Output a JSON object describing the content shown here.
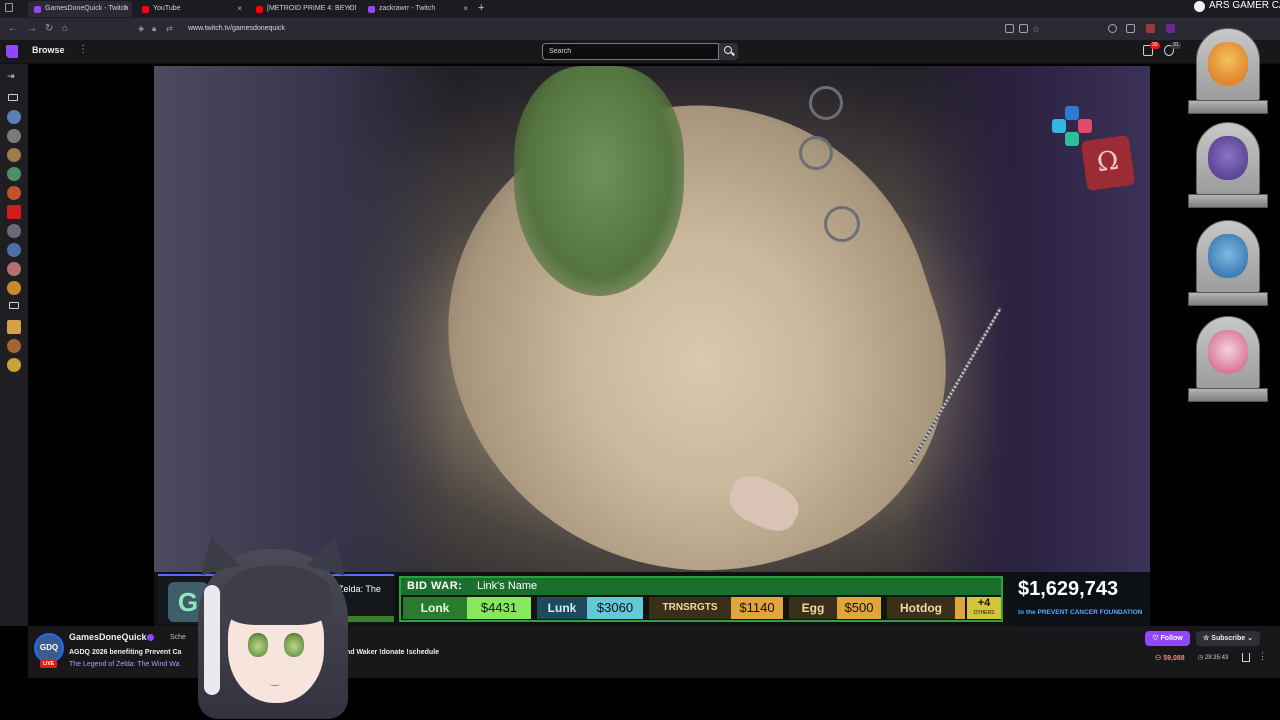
{
  "browser": {
    "tabs": [
      {
        "label": "GamesDoneQuick - Twitch",
        "active": true,
        "favicon_color": "#9146ff"
      },
      {
        "label": "YouTube",
        "active": false,
        "favicon_color": "#ff0000"
      },
      {
        "label": "[METROID PRIME 4: BEYOND]",
        "active": false,
        "favicon_color": "#ff0000"
      },
      {
        "label": "zackrawrr - Twitch",
        "active": false,
        "favicon_color": "#9146ff"
      }
    ],
    "url": "www.twitch.tv/gamesdonequick"
  },
  "twitch_nav": {
    "browse_label": "Browse",
    "search_placeholder": "Search",
    "notification_count": "30",
    "whisper_count": "31"
  },
  "overlay": {
    "game_title": "of Zelda: The\nker",
    "bid_war_label": "BID WAR:",
    "bid_war_name": "Link's Name",
    "options": [
      {
        "name": "Lonk",
        "amount": "$4431"
      },
      {
        "name": "Lunk",
        "amount": "$3060"
      },
      {
        "name": "TRNSRGTS",
        "amount": "$1140"
      },
      {
        "name": "Egg",
        "amount": "$500"
      },
      {
        "name": "Hotdog",
        "amount": ""
      }
    ],
    "others_count": "+4",
    "others_label": "OTHERS",
    "total": "$1,629,743",
    "charity": "to the PREVENT CANCER FOUNDATION"
  },
  "gravestones": [
    "charmeleon",
    "gengar",
    "marshtomp",
    "mr-mime"
  ],
  "stream": {
    "channel": "GamesDoneQuick",
    "live_label": "LIVE",
    "schedule_label": "Sche",
    "title_part1": "AGDQ 2026 benefiting Prevent Ca",
    "title_part2": "ind Waker !donate !schedule",
    "game": "The Legend of Zelda: The Wind Wa",
    "follow_label": "Follow",
    "subscribe_label": "Subscribe",
    "viewers": "59,088",
    "uptime": "28:35:43"
  },
  "cam_overlay": {
    "label": "ARS GAMER CAM"
  },
  "colors": {
    "twitch_purple": "#9146ff",
    "bidwar_green": "#2ea043",
    "charity_blue": "#4fb2ff",
    "live_red": "#e91916"
  }
}
